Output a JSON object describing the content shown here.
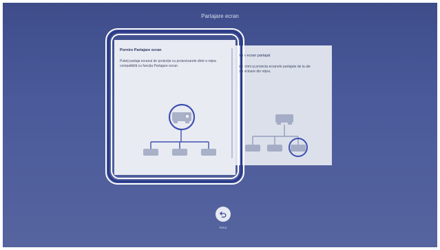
{
  "screen": {
    "title": "Partajare ecran"
  },
  "cards": {
    "start": {
      "title": "Pornire Partajare ecran",
      "description": "Puteți partaja ecranul de proiecție cu proiectoarele dintr-o rețea compatibilă cu funcția Partajare ecran."
    },
    "receive": {
      "title": "rnire ecran partajat",
      "description": "teți primi și proiecta ecranele partajate de la ale proiectoare din rețea."
    }
  },
  "footer": {
    "back_label": "Retur",
    "back_icon": "undo-arrow-icon"
  },
  "colors": {
    "accent": "#2a3a8a",
    "highlight": "#3e4fb0",
    "background": "#46559a"
  }
}
